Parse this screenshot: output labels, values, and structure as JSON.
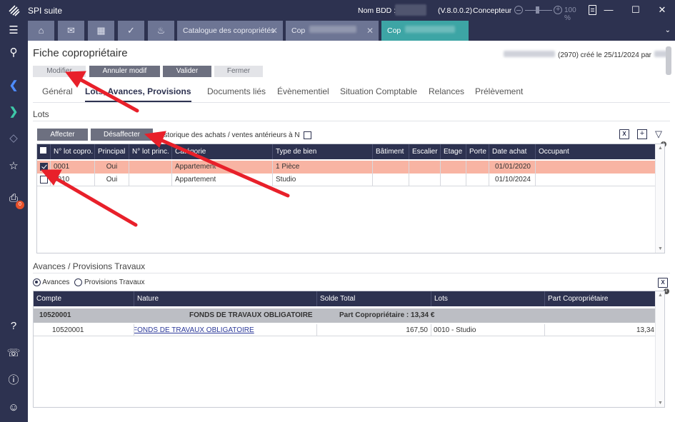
{
  "titlebar": {
    "app_name": "SPI suite",
    "bdd_label": "Nom BDD :",
    "version": "(V.8.0.0.2)",
    "role": "Concepteur",
    "zoom": "100 %"
  },
  "tabs": {
    "catalogue": "Catalogue des copropriétés",
    "cop1": "Cop",
    "cop2": "Cop"
  },
  "page": {
    "title": "Fiche copropriétaire",
    "created": "(2970) créé le 25/11/2024 par"
  },
  "toolbar": {
    "modifier": "Modifier",
    "annuler": "Annuler modif",
    "valider": "Valider",
    "fermer": "Fermer"
  },
  "subtabs": [
    "Général",
    "Lots, Avances, Provisions",
    "Documents liés",
    "Évènementiel",
    "Situation Comptable",
    "Relances",
    "Prélèvement"
  ],
  "lots": {
    "section_title": "Lots",
    "affecter": "Affecter",
    "desaffecter": "Désaffecter",
    "historique": "Historique des achats / ventes antérieurs à N",
    "columns": [
      "N° lot copro.",
      "Principal",
      "N° lot princ.",
      "Catégorie",
      "Type de bien",
      "Bâtiment",
      "Escalier",
      "Etage",
      "Porte",
      "Date achat",
      "Occupant"
    ],
    "rows": [
      {
        "num": "0001",
        "principal": "Oui",
        "lot_princ": "",
        "categorie": "Appartement",
        "type": "1 Pièce",
        "batiment": "",
        "escalier": "",
        "etage": "",
        "porte": "",
        "date": "01/01/2020",
        "occupant": "",
        "checked": true
      },
      {
        "num": "0010",
        "principal": "Oui",
        "lot_princ": "",
        "categorie": "Appartement",
        "type": "Studio",
        "batiment": "",
        "escalier": "",
        "etage": "",
        "porte": "",
        "date": "01/10/2024",
        "occupant": "",
        "checked": false
      }
    ]
  },
  "avances": {
    "section_title": "Avances / Provisions Travaux",
    "radio_avances": "Avances",
    "radio_provisions": "Provisions Travaux",
    "columns": [
      "Compte",
      "Nature",
      "Solde Total",
      "Lots",
      "Part Copropriétaire"
    ],
    "group": {
      "compte": "10520001",
      "nature": "FONDS DE TRAVAUX OBLIGATOIRE",
      "part": "Part Copropriétaire :  13,34 €"
    },
    "rows": [
      {
        "compte": "10520001",
        "nature": "FONDS DE TRAVAUX OBLIGATOIRE",
        "solde": "167,50",
        "lots": "0010 - Studio",
        "part": "13,34"
      }
    ]
  },
  "colors": {
    "navy": "#2d3250",
    "teal": "#3da5a5",
    "selected_row": "#f8b4a3",
    "arrow": "#e8202a"
  }
}
